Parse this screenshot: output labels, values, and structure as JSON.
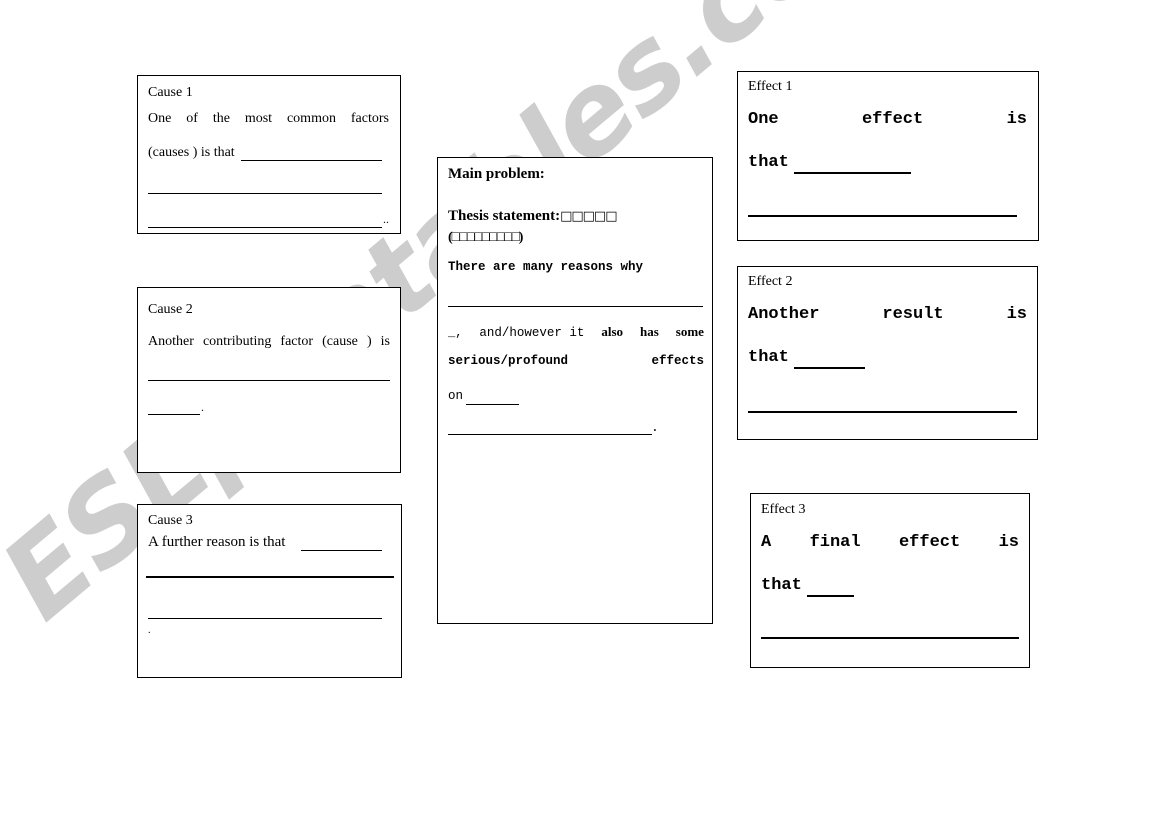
{
  "watermark": "ESLprintables.com",
  "causes": [
    {
      "label": "Cause 1",
      "line1_words": [
        "One",
        "of",
        "the",
        "most",
        "common",
        "factors"
      ],
      "line2": "(causes ) is that",
      "end_mark": ".."
    },
    {
      "label": "Cause 2",
      "line1_words": [
        "Another",
        "contributing",
        "factor",
        "(cause",
        ")",
        "is"
      ],
      "end_mark": "."
    },
    {
      "label": "Cause 3",
      "line1": "A further reason is that",
      "end_mark": "."
    }
  ],
  "main": {
    "title": "Main problem:",
    "thesis_label": "Thesis statement:",
    "thesis_boxes_1": "□□□□□",
    "thesis_boxes_2": "(□□□□□□□□□)",
    "reasons_line": "There are many reasons why",
    "connector_prefix": "_,",
    "connector_text": "and/however it",
    "also_words": [
      "also",
      "has",
      "some"
    ],
    "effects_words": [
      "serious/profound",
      "effects"
    ],
    "on_text": "on",
    "end_mark": "."
  },
  "effects": [
    {
      "label": "Effect 1",
      "line1_words": [
        "One",
        "effect",
        "is"
      ],
      "line2": "that"
    },
    {
      "label": "Effect 2",
      "line1_words": [
        "Another",
        "result",
        "is"
      ],
      "line2": "that"
    },
    {
      "label": "Effect 3",
      "line1_words": [
        "A",
        "final",
        "effect",
        "is"
      ],
      "line2": "that"
    }
  ]
}
